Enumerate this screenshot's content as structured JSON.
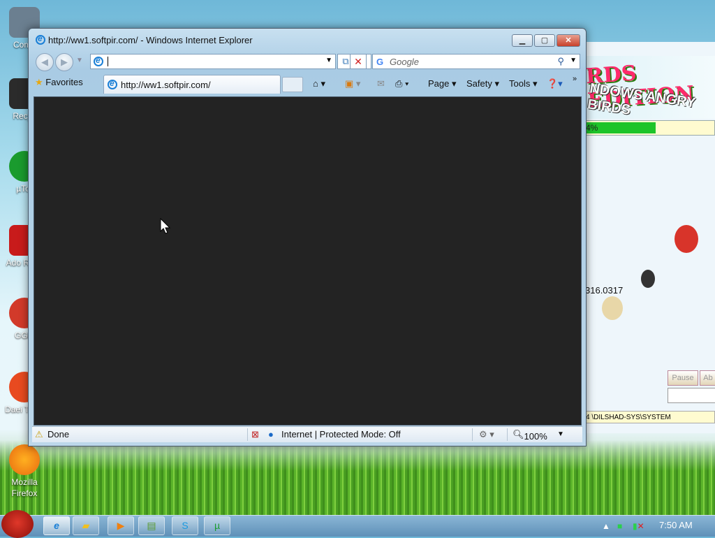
{
  "desktop": {
    "icons": [
      {
        "label": "Comp",
        "icon": "computer-icon",
        "color": "#6b7f90"
      },
      {
        "label": "Recyc",
        "icon": "recycle-bin-icon",
        "color": "#2b2b2b"
      },
      {
        "label": "µTor",
        "icon": "utorrent-icon",
        "color": "#1a9b2e"
      },
      {
        "label": "Ado Reac",
        "icon": "adobe-reader-icon",
        "color": "#c81b1b"
      },
      {
        "label": "GGle",
        "icon": "app-icon",
        "color": "#d23a2a"
      },
      {
        "label": "Daei Tools",
        "icon": "daemon-tools-icon",
        "color": "#e84a20"
      },
      {
        "label": "Mozilla Firefox",
        "icon": "firefox-icon",
        "color": "#e86a10"
      }
    ]
  },
  "background_app": {
    "title": "RDS EDITION",
    "subtitle": "NDOWS ANGRY BIRDS",
    "progress_text": "4%",
    "progress_fraction": 0.55,
    "version": "316.0317",
    "pause_label": "Pause",
    "abort_label": "Ab",
    "path": "4     \\DILSHAD-SYS\\SYSTEM"
  },
  "ie": {
    "title": "http://ww1.softpir.com/ - Windows Internet Explorer",
    "address_value": "",
    "search_placeholder": "Google",
    "favorites_label": "Favorites",
    "tab_label": "http://ww1.softpir.com/",
    "commands": {
      "page": "Page",
      "safety": "Safety",
      "tools": "Tools"
    },
    "status_text": "Done",
    "zone_text": "Internet | Protected Mode: Off",
    "zoom": "100%"
  },
  "taskbar": {
    "clock": "7:50 AM",
    "items": [
      "ie-icon",
      "folder-icon",
      "media-player-icon",
      "archive-icon",
      "skype-icon",
      "utorrent-icon"
    ]
  }
}
